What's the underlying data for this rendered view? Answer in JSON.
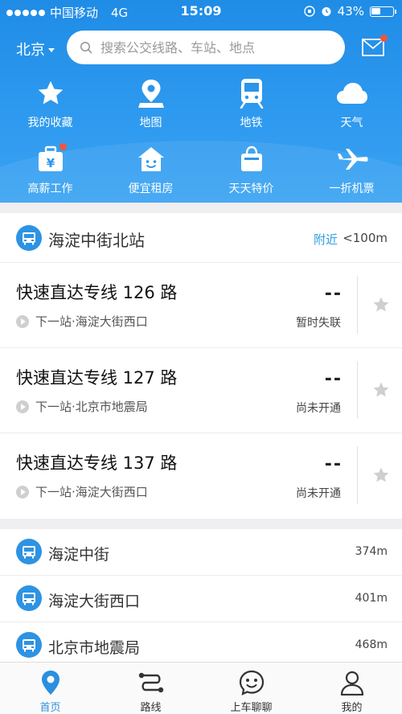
{
  "status_bar": {
    "carrier": "中国移动",
    "network": "4G",
    "time": "15:09",
    "battery": "43%"
  },
  "header": {
    "city": "北京",
    "search_placeholder": "搜索公交线路、车站、地点"
  },
  "colors": {
    "primary": "#1f8ce6",
    "accent_blue": "#2f9ee0",
    "badge_red": "#f0553e"
  },
  "quick_actions": [
    {
      "label": "我的收藏",
      "icon": "star-icon"
    },
    {
      "label": "地图",
      "icon": "map-pin-icon"
    },
    {
      "label": "地铁",
      "icon": "subway-icon"
    },
    {
      "label": "天气",
      "icon": "cloud-icon"
    },
    {
      "label": "高薪工作",
      "icon": "job-bag-icon"
    },
    {
      "label": "便宜租房",
      "icon": "house-icon"
    },
    {
      "label": "天天特价",
      "icon": "shopping-bag-icon"
    },
    {
      "label": "一折机票",
      "icon": "airplane-icon"
    }
  ],
  "nearest_station": {
    "name": "海淀中街北站",
    "nearby_label": "附近",
    "distance": "<100m",
    "routes": [
      {
        "name": "快速直达专线 126 路",
        "next_stop": "下一站·海淀大街西口",
        "eta": "--",
        "status": "暂时失联"
      },
      {
        "name": "快速直达专线 127 路",
        "next_stop": "下一站·北京市地震局",
        "eta": "--",
        "status": "尚未开通"
      },
      {
        "name": "快速直达专线 137 路",
        "next_stop": "下一站·海淀大街西口",
        "eta": "--",
        "status": "尚未开通"
      }
    ]
  },
  "other_stations": [
    {
      "name": "海淀中街",
      "distance": "374m"
    },
    {
      "name": "海淀大街西口",
      "distance": "401m"
    },
    {
      "name": "北京市地震局",
      "distance": "468m"
    }
  ],
  "tabbar": [
    {
      "label": "首页",
      "icon": "location-pin-icon",
      "active": true
    },
    {
      "label": "路线",
      "icon": "route-icon",
      "active": false
    },
    {
      "label": "上车聊聊",
      "icon": "chat-face-icon",
      "active": false
    },
    {
      "label": "我的",
      "icon": "person-icon",
      "active": false
    }
  ]
}
